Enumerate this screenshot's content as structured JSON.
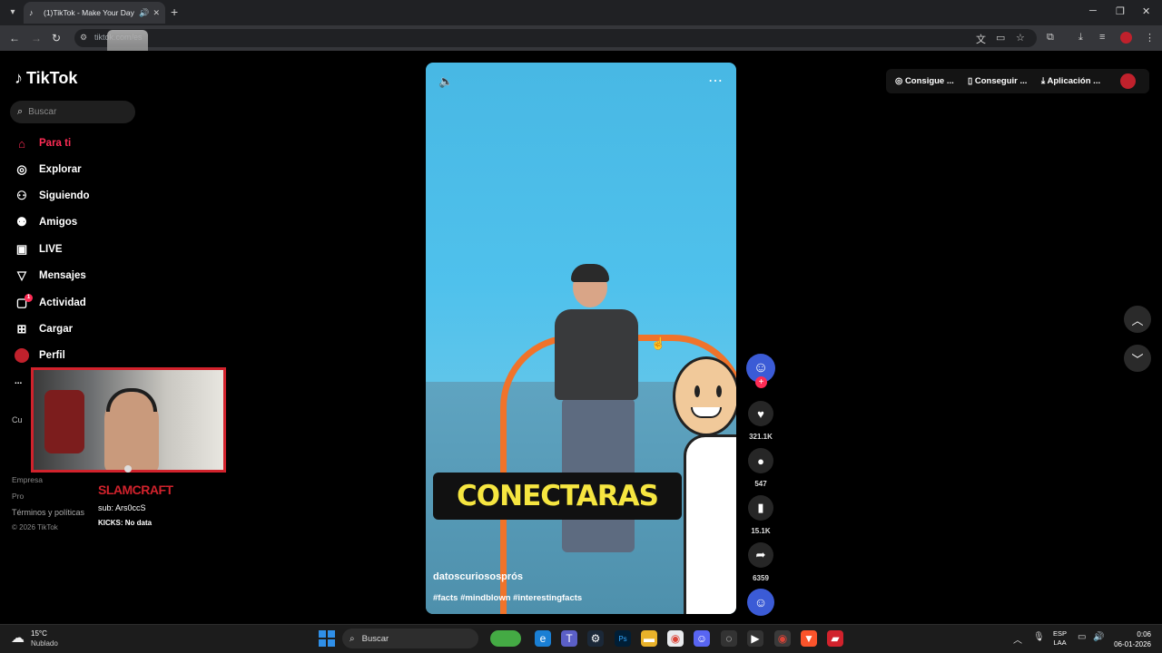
{
  "browser": {
    "tab_title": "(1)TikTok - Make Your Day",
    "url": "tiktok.com/es",
    "new_tab": "+",
    "win_min": "─",
    "win_max": "❐",
    "win_close": "✕"
  },
  "tiktok": {
    "logo": "TikTok",
    "search_placeholder": "Buscar",
    "nav": [
      {
        "label": "Para ti",
        "icon": "home-icon"
      },
      {
        "label": "Explorar",
        "icon": "compass-icon"
      },
      {
        "label": "Siguiendo",
        "icon": "following-icon"
      },
      {
        "label": "Amigos",
        "icon": "friends-icon"
      },
      {
        "label": "LIVE",
        "icon": "live-icon"
      },
      {
        "label": "Mensajes",
        "icon": "messages-icon"
      },
      {
        "label": "Actividad",
        "icon": "activity-icon",
        "badge": "1"
      },
      {
        "label": "Cargar",
        "icon": "upload-icon"
      },
      {
        "label": "Perfil",
        "icon": "profile-avatar"
      }
    ],
    "more_label": "...",
    "footer": {
      "cut1": "Cu",
      "company": "Empresa",
      "program": "Pro",
      "terms": "Términos y políticas",
      "copyright": "© 2026 TikTok"
    },
    "topbar": {
      "coins": "Consigue ...",
      "get_app": "Conseguir ...",
      "app": "Aplicación ..."
    }
  },
  "video": {
    "caption": "CONECTARAS",
    "author": "datoscuriososprós",
    "hashtags": "#facts #mindblown #interestingfacts",
    "likes": "321.1K",
    "comments": "547",
    "saves": "15.1K",
    "shares": "6359",
    "follow_plus": "+"
  },
  "stream_overlay": {
    "name": "SLAMCRAFT",
    "sub": "sub: Ars0ccS",
    "kicks": "KICKS: No data"
  },
  "taskbar": {
    "temp": "15°C",
    "weather": "Nublado",
    "search": "Buscar",
    "lang1": "ESP",
    "lang2": "LAA",
    "time": "0:06",
    "date": "06-01-2026"
  },
  "colors": {
    "accent": "#fe2c55",
    "overlay_red": "#d1222c",
    "caption_yellow": "#f6e640"
  }
}
